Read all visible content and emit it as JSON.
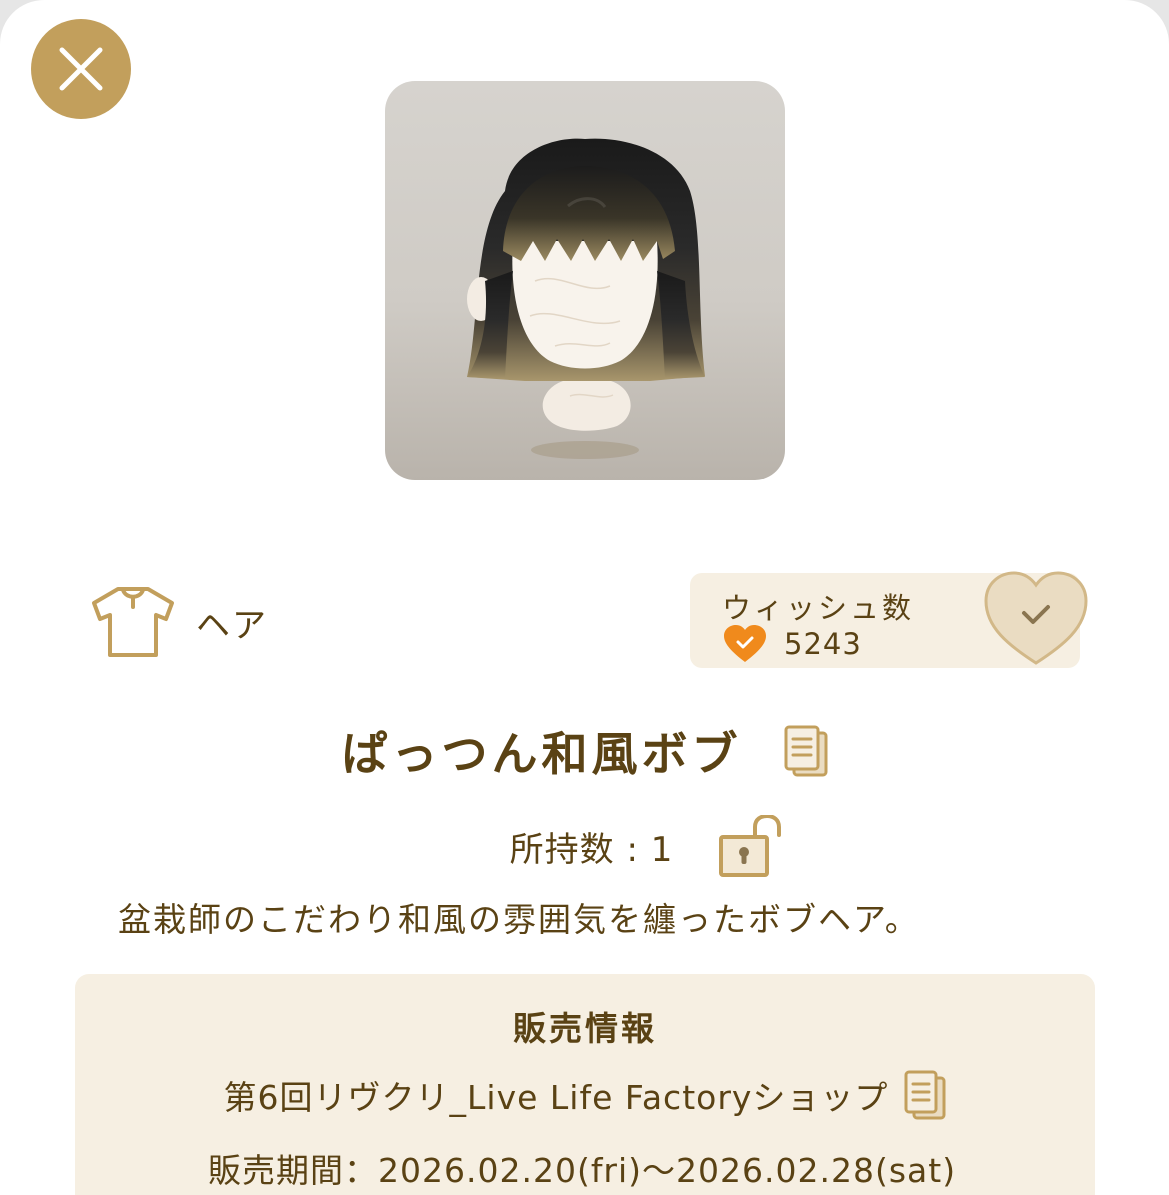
{
  "item": {
    "category": "ヘア",
    "name": "ぱっつん和風ボブ",
    "owned_label": "所持数",
    "owned_count": "1",
    "description": "盆栽師のこだわり和風の雰囲気を纏ったボブヘア。"
  },
  "wish": {
    "label": "ウィッシュ数",
    "count": "5243"
  },
  "sales": {
    "title": "販売情報",
    "shop": "第6回リヴクリ_Live Life Factoryショップ",
    "period_label": "販売期間",
    "period_value": "2026.02.20(fri)〜2026.02.28(sat)"
  },
  "colors": {
    "accent_gold": "#c29f5c",
    "text_brown": "#5a4214",
    "panel_cream": "#f6efe2",
    "wish_orange": "#f08a1c"
  },
  "icons": [
    "close-icon",
    "shirt-icon",
    "heart-check-icon",
    "wish-heart-button-icon",
    "copy-document-icon",
    "unlocked-padlock-icon"
  ]
}
